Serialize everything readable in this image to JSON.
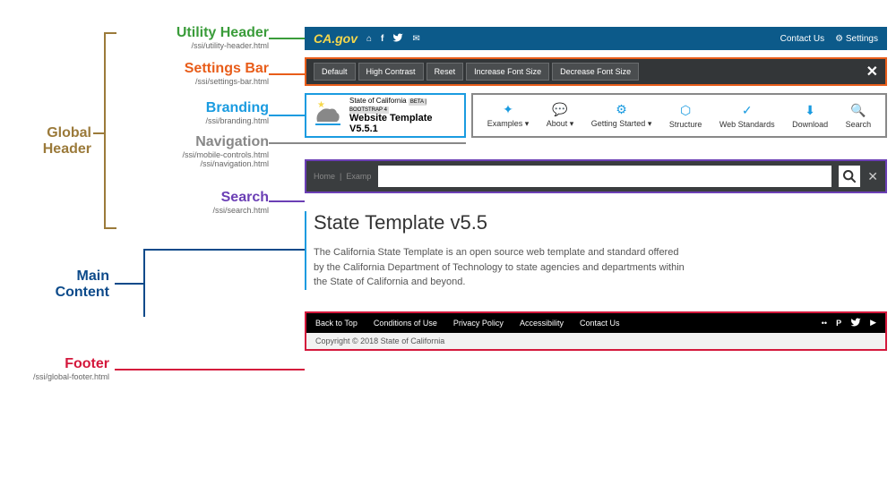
{
  "labels": {
    "global_header": "Global Header",
    "utility_header": "Utility Header",
    "utility_header_path": "/ssi/utility-header.html",
    "settings_bar": "Settings Bar",
    "settings_bar_path": "/ssi/settings-bar.html",
    "branding": "Branding",
    "branding_path": "/ssi/branding.html",
    "navigation": "Navigation",
    "navigation_path1": "/ssi/mobile-controls.html",
    "navigation_path2": "/ssi/navigation.html",
    "search": "Search",
    "search_path": "/ssi/search.html",
    "main_content_1": "Main",
    "main_content_2": "Content",
    "footer": "Footer",
    "footer_path": "/ssi/global-footer.html"
  },
  "utility": {
    "logo": "CA.gov",
    "contact": "Contact Us",
    "settings": "Settings"
  },
  "settings": {
    "default": "Default",
    "high_contrast": "High Contrast",
    "reset": "Reset",
    "increase": "Increase Font Size",
    "decrease": "Decrease Font Size"
  },
  "branding": {
    "line1": "State of California",
    "badge": "BETA | BOOTSTRAP 4",
    "line2": "Website Template V5.5.1"
  },
  "nav": {
    "examples": "Examples",
    "about": "About",
    "getting_started": "Getting Started",
    "structure": "Structure",
    "web_standards": "Web Standards",
    "download": "Download",
    "search": "Search"
  },
  "search": {
    "crumb1": "Home",
    "crumb2": "Examp"
  },
  "main": {
    "heading": "State Template v5.5",
    "para": "The California State Template is an open source web template and standard offered by the California Department of Technology to state agencies and departments within the State of California and beyond."
  },
  "footer": {
    "back_to_top": "Back to Top",
    "conditions": "Conditions of Use",
    "privacy": "Privacy Policy",
    "accessibility": "Accessibility",
    "contact": "Contact Us",
    "copyright": "Copyright © 2018 State of California"
  }
}
